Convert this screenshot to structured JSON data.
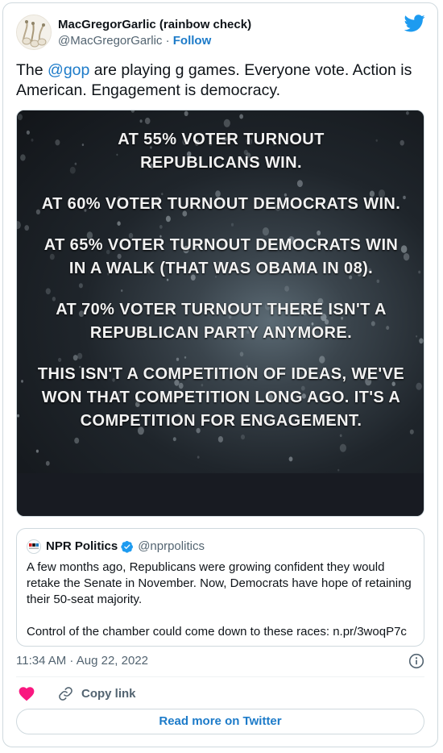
{
  "header": {
    "display_name": "MacGregorGarlic (rainbow check)",
    "handle": "@MacGregorGarlic",
    "separator": " · ",
    "follow_label": "Follow"
  },
  "tweet": {
    "text_before": "The ",
    "mention": "@gop",
    "text_after": " are playing g games. Everyone vote. Action is American. Engagement is democracy."
  },
  "media": {
    "lines": [
      "AT 55% VOTER TURNOUT\nREPUBLICANS WIN.",
      "AT 60% VOTER TURNOUT DEMOCRATS WIN.",
      "AT 65% VOTER TURNOUT DEMOCRATS WIN\nIN A WALK (THAT WAS OBAMA IN 08).",
      "AT 70% VOTER TURNOUT THERE ISN'T A\nREPUBLICAN PARTY ANYMORE.",
      "THIS ISN'T A COMPETITION OF IDEAS, WE'VE\nWON THAT COMPETITION LONG AGO. IT'S A\nCOMPETITION FOR ENGAGEMENT."
    ]
  },
  "quote": {
    "name": "NPR Politics",
    "handle": "@nprpolitics",
    "logo_text": "npr",
    "text": "A few months ago, Republicans were growing confident they would retake the Senate in November.  Now, Democrats have hope of retaining their 50-seat majority.\n\nControl of the chamber could come down to these races: n.pr/3woqP7c"
  },
  "meta": {
    "timestamp": "11:34 AM · Aug 22, 2022"
  },
  "actions": {
    "copy_link_label": "Copy link",
    "read_more_label": "Read more on Twitter"
  },
  "colors": {
    "accent": "#1d7bc9",
    "like": "#f91880",
    "verified": "#1d9bf0"
  }
}
